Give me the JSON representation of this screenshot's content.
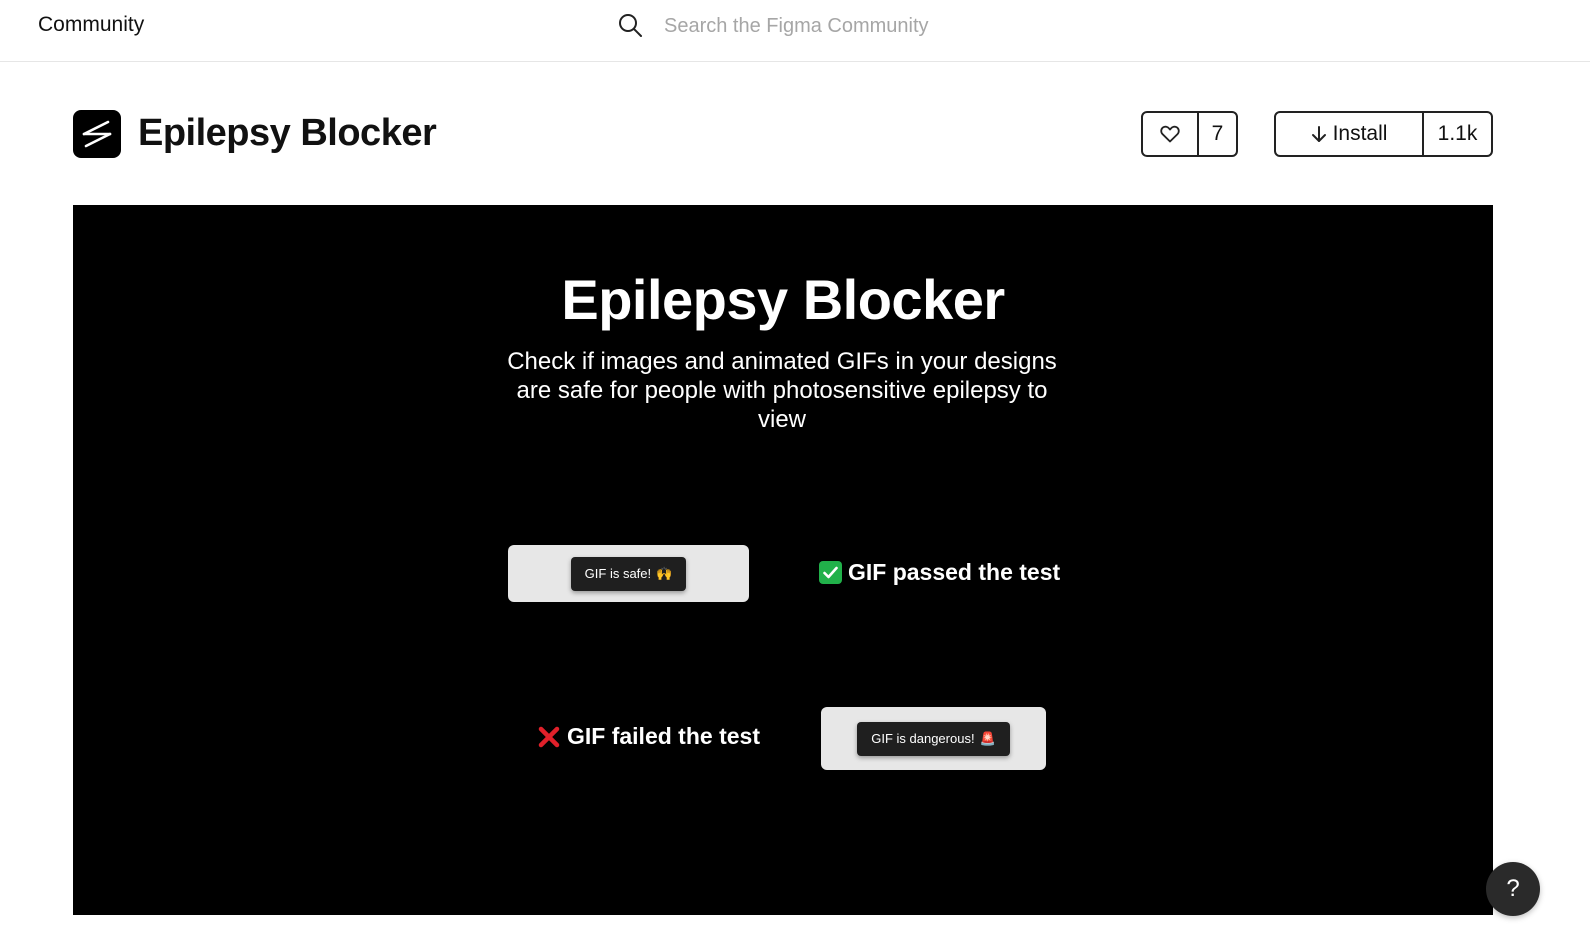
{
  "topbar": {
    "brand": "Community",
    "search_placeholder": "Search the Figma Community",
    "search_value": "",
    "search_icon": "search-icon"
  },
  "plugin": {
    "name": "Epilepsy Blocker",
    "icon": "lightning-slash-icon",
    "like_icon": "heart-icon",
    "like_count": "7",
    "install_icon": "arrow-down-icon",
    "install_label": "Install",
    "install_count": "1.1k"
  },
  "preview": {
    "title": "Epilepsy Blocker",
    "subtitle": "Check if images and animated GIFs in your designs are safe for people with photosensitive epilepsy to view",
    "safe_toast": "GIF is safe!",
    "safe_emoji": "🙌",
    "pass_text": "GIF passed the test",
    "fail_text": "GIF failed the test",
    "danger_toast": "GIF is dangerous!",
    "danger_emoji": "🚨"
  },
  "help": {
    "label": "?"
  },
  "colors": {
    "preview_background": "#000000",
    "check_green": "#21b14a",
    "x_red": "#e0202a",
    "toast_background": "#1f1f1f",
    "card_background": "#e7e7e7"
  }
}
